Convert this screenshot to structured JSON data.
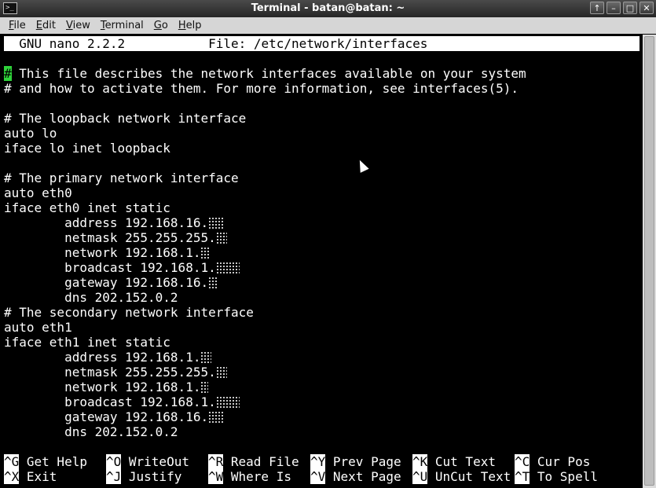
{
  "window": {
    "title": "Terminal - batan@batan: ~",
    "app_icon_text": ">_",
    "buttons": [
      "↑",
      "–",
      "□",
      "✕"
    ]
  },
  "menu": [
    "File",
    "Edit",
    "View",
    "Terminal",
    "Go",
    "Help"
  ],
  "nano": {
    "header": "  GNU nano 2.2.2           File: /etc/network/interfaces",
    "lines": [
      {
        "text": " This file describes the network interfaces available on your system",
        "cursor_char": "#"
      },
      {
        "text": "# and how to activate them. For more information, see interfaces(5)."
      },
      {
        "text": ""
      },
      {
        "text": "# The loopback network interface"
      },
      {
        "text": "auto lo"
      },
      {
        "text": "iface lo inet loopback"
      },
      {
        "text": ""
      },
      {
        "text": "# The primary network interface"
      },
      {
        "text": "auto eth0"
      },
      {
        "text": "iface eth0 inet static"
      },
      {
        "text": "        address 192.168.16.",
        "mask": 20
      },
      {
        "text": "        netmask 255.255.255.",
        "mask": 14
      },
      {
        "text": "        network 192.168.1.",
        "mask": 12
      },
      {
        "text": "        broadcast 192.168.1.",
        "mask": 30
      },
      {
        "text": "        gateway 192.168.16.",
        "mask": 12
      },
      {
        "text": "        dns 202.152.0.2"
      },
      {
        "text": "# The secondary network interface"
      },
      {
        "text": "auto eth1"
      },
      {
        "text": "iface eth1 inet static"
      },
      {
        "text": "        address 192.168.1.",
        "mask": 14
      },
      {
        "text": "        netmask 255.255.255.",
        "mask": 14
      },
      {
        "text": "        network 192.168.1.",
        "mask": 10
      },
      {
        "text": "        broadcast 192.168.1.",
        "mask": 30
      },
      {
        "text": "        gateway 192.168.16.",
        "mask": 20
      },
      {
        "text": "        dns 202.152.0.2"
      }
    ],
    "shortcuts_row1": [
      {
        "key": "^G",
        "label": " Get Help"
      },
      {
        "key": "^O",
        "label": " WriteOut"
      },
      {
        "key": "^R",
        "label": " Read File"
      },
      {
        "key": "^Y",
        "label": " Prev Page"
      },
      {
        "key": "^K",
        "label": " Cut Text"
      },
      {
        "key": "^C",
        "label": " Cur Pos"
      }
    ],
    "shortcuts_row2": [
      {
        "key": "^X",
        "label": " Exit"
      },
      {
        "key": "^J",
        "label": " Justify"
      },
      {
        "key": "^W",
        "label": " Where Is"
      },
      {
        "key": "^V",
        "label": " Next Page"
      },
      {
        "key": "^U",
        "label": " UnCut Text"
      },
      {
        "key": "^T",
        "label": " To Spell"
      }
    ]
  }
}
